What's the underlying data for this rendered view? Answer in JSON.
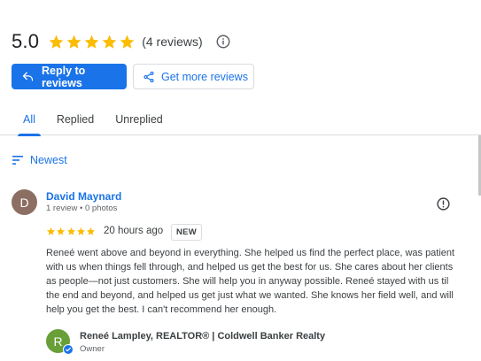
{
  "summary": {
    "rating": "5.0",
    "star_count": 5,
    "reviews_label": "(4 reviews)",
    "star_color": "#fbbc04",
    "info_icon": "info-icon"
  },
  "actions": {
    "reply_label": "Reply to reviews",
    "reply_icon": "reply-icon",
    "more_label": "Get more reviews",
    "more_icon": "share-icon",
    "accent": "#1a73e8"
  },
  "tabs": [
    {
      "label": "All",
      "active": true
    },
    {
      "label": "Replied",
      "active": false
    },
    {
      "label": "Unreplied",
      "active": false
    }
  ],
  "sort": {
    "label": "Newest",
    "icon": "sort-icon"
  },
  "review": {
    "avatar_letter": "D",
    "avatar_color": "#8d6e63",
    "name": "David Maynard",
    "meta": "1 review • 0 photos",
    "stars": 5,
    "time": "20 hours ago",
    "badge": "NEW",
    "text": "Reneé went above and beyond in everything. She helped us find the perfect place, was patient with us when things fell through, and helped us get the best for us. She cares about her clients as people—not just customers. She will help you in anyway possible. Reneé stayed with us til the end and beyond, and helped us get just what we wanted. She knows her field well, and will help you get the best. I can't recommend her enough.",
    "report_icon": "report-icon"
  },
  "owner": {
    "avatar_letter": "R",
    "avatar_color": "#689f38",
    "name": "Reneé Lampley, REALTOR® | Coldwell Banker Realty",
    "role": "Owner",
    "verified_icon": "verified-check-icon"
  }
}
